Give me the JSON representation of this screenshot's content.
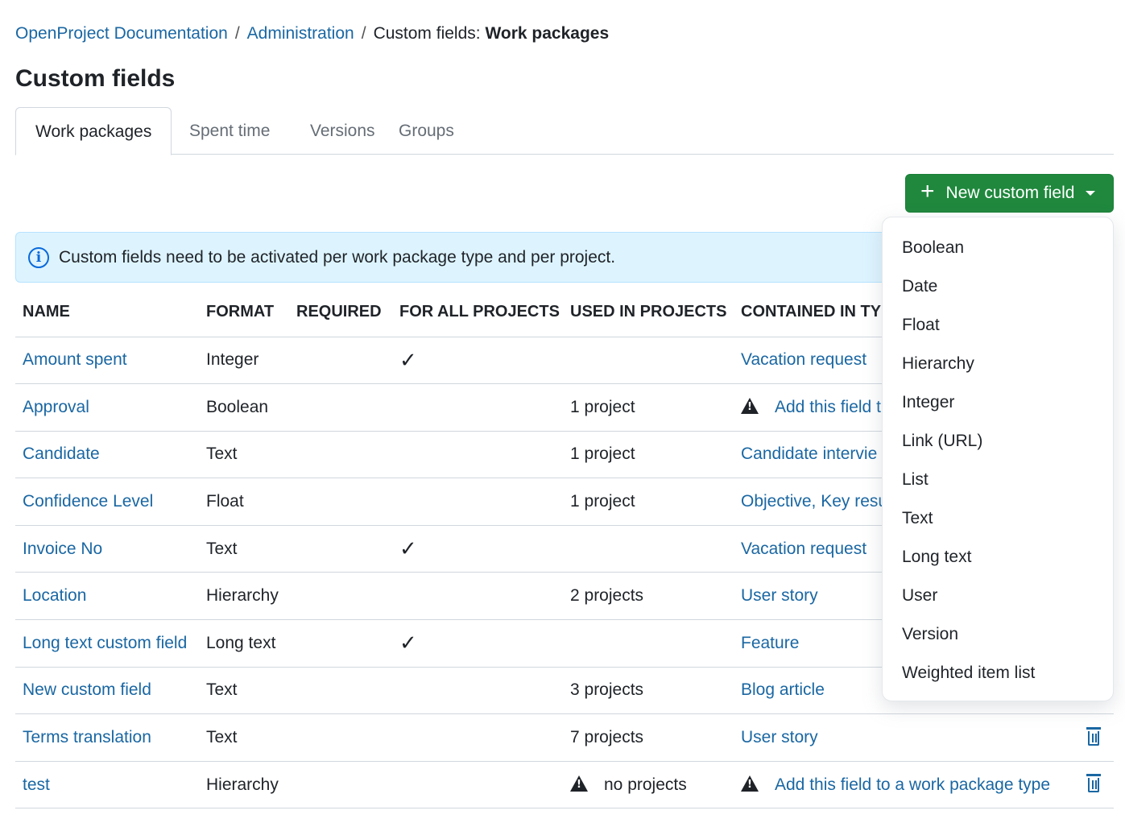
{
  "breadcrumb": {
    "items": [
      "OpenProject Documentation",
      "Administration"
    ],
    "separator": "/",
    "current_prefix": "Custom fields: ",
    "current_bold": "Work packages"
  },
  "page_title": "Custom fields",
  "tabs": [
    "Work packages",
    "Spent time",
    "Versions",
    "Groups"
  ],
  "new_button": {
    "label": "New custom field",
    "color": "#1f883d"
  },
  "flash": {
    "message": "Custom fields need to be activated per work package type and per project."
  },
  "table": {
    "headers": [
      "NAME",
      "FORMAT",
      "REQUIRED",
      "FOR ALL PROJECTS",
      "USED IN PROJECTS",
      "CONTAINED IN TY"
    ],
    "rows": [
      {
        "name": "Amount spent",
        "format": "Integer",
        "for_all": "✓",
        "used": "",
        "used_warn": false,
        "types": "Vacation request",
        "types_warn": false,
        "delete": false
      },
      {
        "name": "Approval",
        "format": "Boolean",
        "for_all": "",
        "used": "1 project",
        "used_warn": false,
        "types": "Add this field t",
        "types_warn": true,
        "delete": false
      },
      {
        "name": "Candidate",
        "format": "Text",
        "for_all": "",
        "used": "1 project",
        "used_warn": false,
        "types": "Candidate intervie",
        "types_warn": false,
        "delete": false
      },
      {
        "name": "Confidence Level",
        "format": "Float",
        "for_all": "",
        "used": "1 project",
        "used_warn": false,
        "types": "Objective, Key resu",
        "types_warn": false,
        "delete": false
      },
      {
        "name": "Invoice No",
        "format": "Text",
        "for_all": "✓",
        "used": "",
        "used_warn": false,
        "types": "Vacation request",
        "types_warn": false,
        "delete": false
      },
      {
        "name": "Location",
        "format": "Hierarchy",
        "for_all": "",
        "used": "2 projects",
        "used_warn": false,
        "types": "User story",
        "types_warn": false,
        "delete": false
      },
      {
        "name": "Long text custom field",
        "format": "Long text",
        "for_all": "✓",
        "used": "",
        "used_warn": false,
        "types": "Feature",
        "types_warn": false,
        "delete": false
      },
      {
        "name": "New custom field",
        "format": "Text",
        "for_all": "",
        "used": "3 projects",
        "used_warn": false,
        "types": "Blog article",
        "types_warn": false,
        "delete": false
      },
      {
        "name": "Terms translation",
        "format": "Text",
        "for_all": "",
        "used": "7 projects",
        "used_warn": false,
        "types": "User story",
        "types_warn": false,
        "delete": true
      },
      {
        "name": "test",
        "format": "Hierarchy",
        "for_all": "",
        "used": "no projects",
        "used_warn": true,
        "types": "Add this field to a work package type",
        "types_warn": true,
        "delete": true
      }
    ]
  },
  "dropdown": {
    "items": [
      "Boolean",
      "Date",
      "Float",
      "Hierarchy",
      "Integer",
      "Link (URL)",
      "List",
      "Text",
      "Long text",
      "User",
      "Version",
      "Weighted item list"
    ]
  }
}
